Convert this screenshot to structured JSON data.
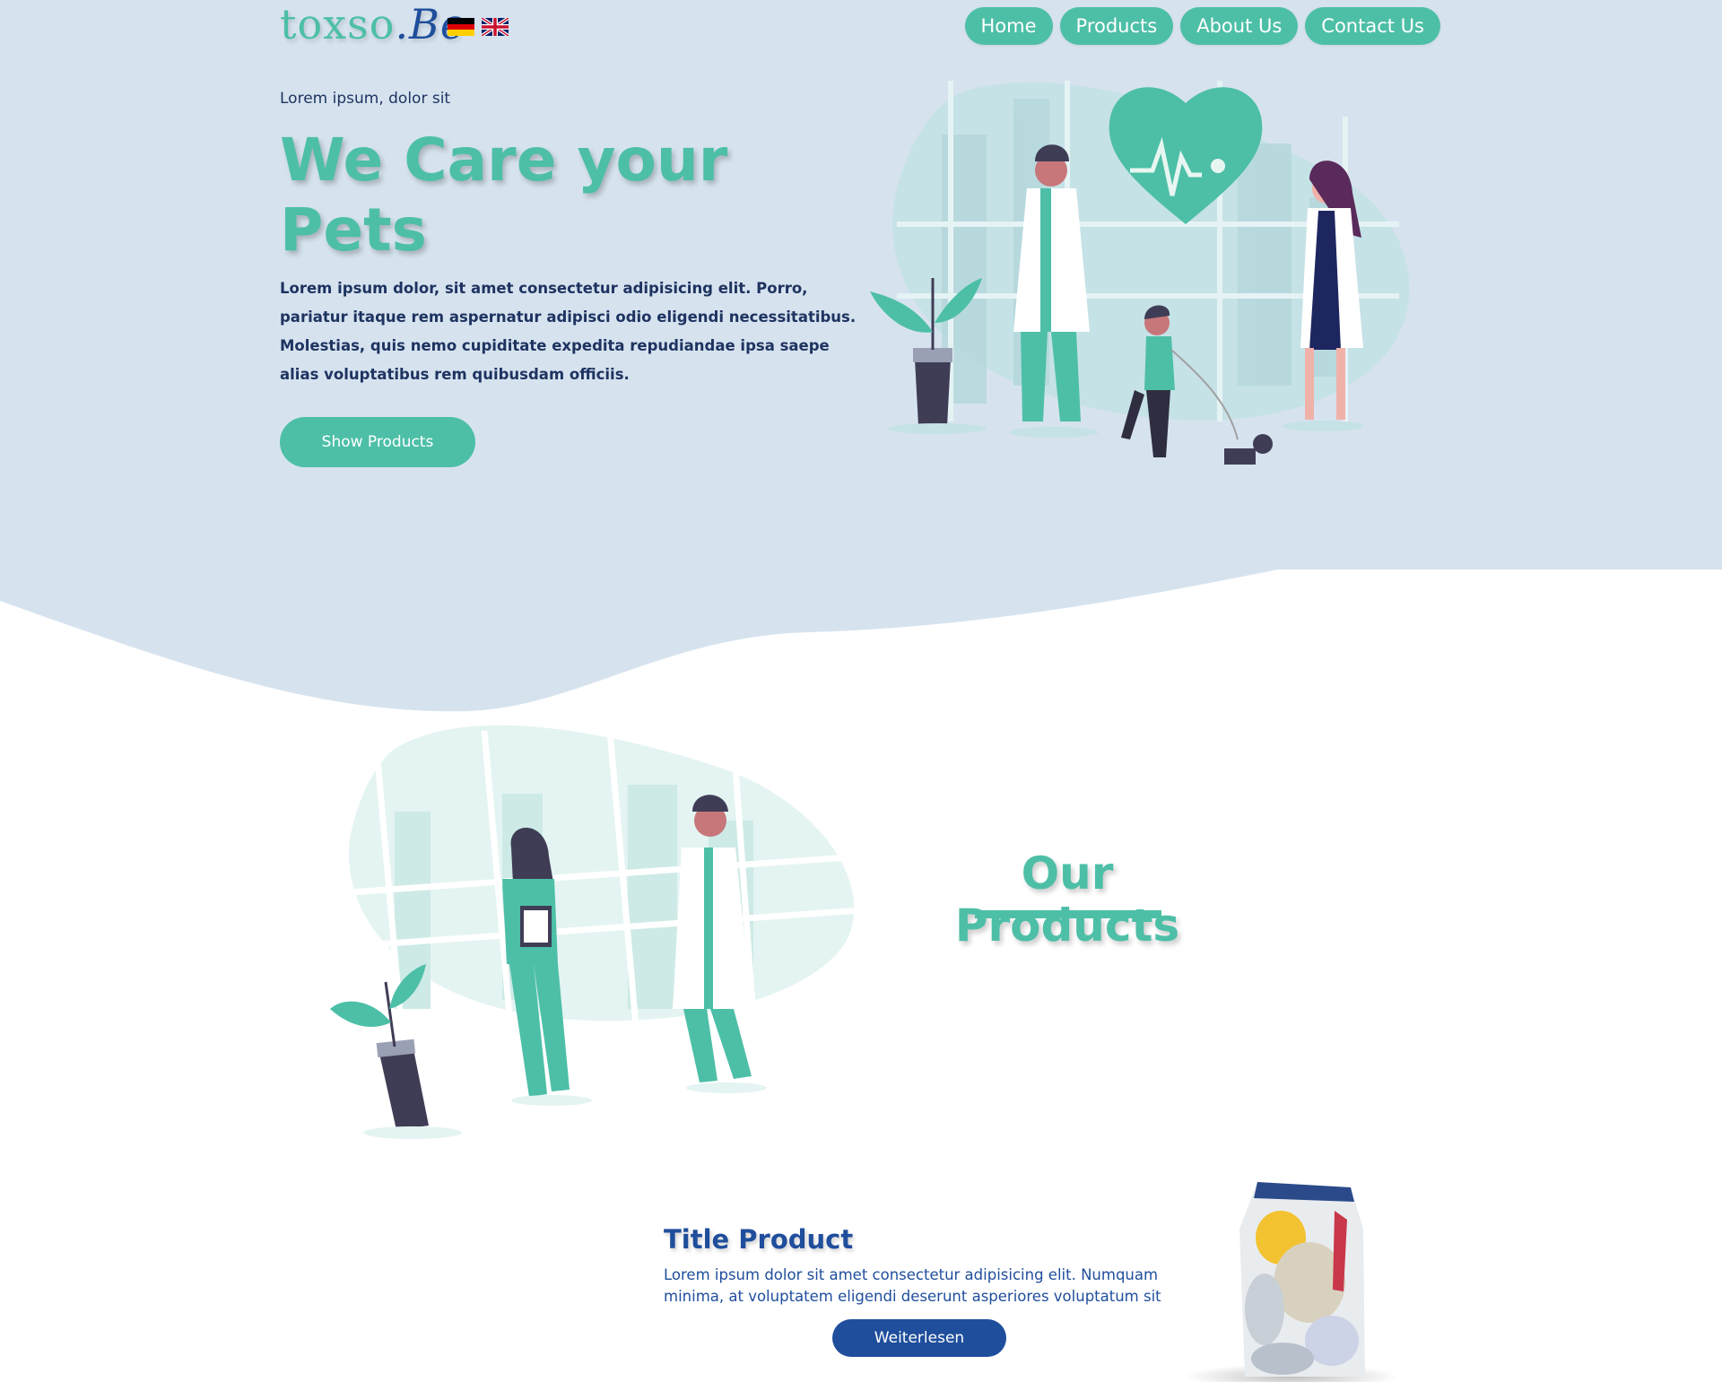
{
  "brand": {
    "logo_main": "toxso",
    "logo_suffix": ".Be"
  },
  "languages": [
    "German flag",
    "UK flag"
  ],
  "nav": [
    {
      "label": "Home"
    },
    {
      "label": "Products"
    },
    {
      "label": "About Us"
    },
    {
      "label": "Contact Us"
    }
  ],
  "hero": {
    "kicker": "Lorem ipsum, dolor sit",
    "title": "We Care your Pets",
    "text": "Lorem ipsum dolor, sit amet consectetur adipisicing elit. Porro, pariatur itaque rem aspernatur adipisci odio eligendi necessitatibus. Molestias, quis nemo cupiditate expedita repudiandae ipsa saepe alias voluptatibus rem quibusdam officiis.",
    "cta": "Show Products"
  },
  "products_section": {
    "heading": "Our Products"
  },
  "product": {
    "title": "Title Product",
    "description": "Lorem ipsum dolor sit amet consectetur adipisicing elit. Numquam minima, at voluptatem eligendi deserunt asperiores voluptatum sit",
    "button": "Weiterlesen"
  },
  "colors": {
    "primary": "#4dbfa7",
    "secondary": "#1f4e9c",
    "hero_bg": "#d6e3ef",
    "text_dark": "#1e3360"
  },
  "icons": [
    "heart-pulse-icon",
    "plant-icon"
  ]
}
